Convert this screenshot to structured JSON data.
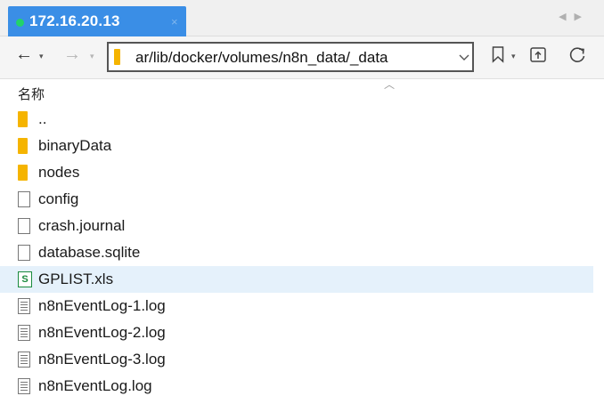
{
  "tab": {
    "title": "172.16.20.13",
    "close_glyph": "×",
    "status_color": "#22d36a",
    "accent": "#3a8ee6"
  },
  "nav": {
    "back": "←",
    "forward": "→",
    "caret": "▾"
  },
  "address": {
    "path": "ar/lib/docker/volumes/n8n_data/_data"
  },
  "toolbar_icons": [
    "bookmark-icon",
    "new-tab-icon",
    "refresh-icon"
  ],
  "list": {
    "column_header": "名称",
    "items": [
      {
        "name": "..",
        "type": "folder"
      },
      {
        "name": "binaryData",
        "type": "folder"
      },
      {
        "name": "nodes",
        "type": "folder"
      },
      {
        "name": "config",
        "type": "file"
      },
      {
        "name": "crash.journal",
        "type": "file"
      },
      {
        "name": "database.sqlite",
        "type": "file"
      },
      {
        "name": "GPLIST.xls",
        "type": "spreadsheet",
        "selected": true
      },
      {
        "name": "n8nEventLog-1.log",
        "type": "log"
      },
      {
        "name": "n8nEventLog-2.log",
        "type": "log"
      },
      {
        "name": "n8nEventLog-3.log",
        "type": "log"
      },
      {
        "name": "n8nEventLog.log",
        "type": "log"
      }
    ]
  }
}
